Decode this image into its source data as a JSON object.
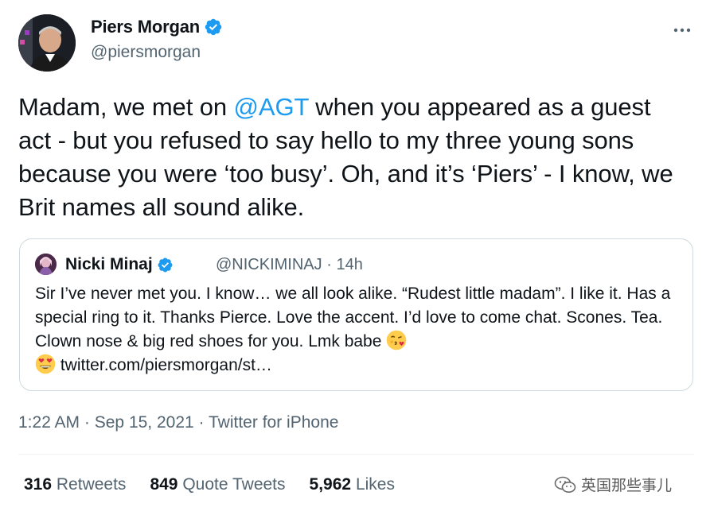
{
  "author": {
    "name": "Piers Morgan",
    "handle": "@piersmorgan",
    "verified": true
  },
  "tweet": {
    "text_before_mention": "Madam, we met on ",
    "mention": "@AGT",
    "text_after_mention": " when you appeared as a guest act - but you refused to say hello to my three young sons because you were ‘too busy’. Oh, and it’s ‘Piers’ - I know, we Brit names all sound alike."
  },
  "quoted_tweet": {
    "name": "Nicki Minaj",
    "handle": "@NICKIMINAJ",
    "separator": "·",
    "age": "14h",
    "text": "Sir I’ve never met you. I know… we all look alike. “Rudest little madam”. I like it. Has a special ring to it. Thanks Pierce. Love the accent. I’d love to come chat. Scones. Tea. Clown nose & big red shoes for you. Lmk babe",
    "link": "twitter.com/piersmorgan/st…",
    "emojis": [
      "face-blowing-kiss-icon",
      "heart-eyes-icon"
    ]
  },
  "meta": {
    "time": "1:22 AM",
    "separator": "·",
    "date": "Sep 15, 2021",
    "source": "Twitter for iPhone"
  },
  "stats": {
    "retweets_count": "316",
    "retweets_label": "Retweets",
    "quotes_count": "849",
    "quotes_label": "Quote Tweets",
    "likes_count": "5,962",
    "likes_label": "Likes"
  },
  "watermark": {
    "text": "英国那些事儿"
  },
  "colors": {
    "accent": "#1d9bf0",
    "text": "#0f1419",
    "secondary": "#536471",
    "border": "#cfd9de"
  },
  "icons": {
    "more": "more-horizontal-icon",
    "verified": "verified-badge-icon",
    "watermark": "wechat-logo-icon"
  }
}
